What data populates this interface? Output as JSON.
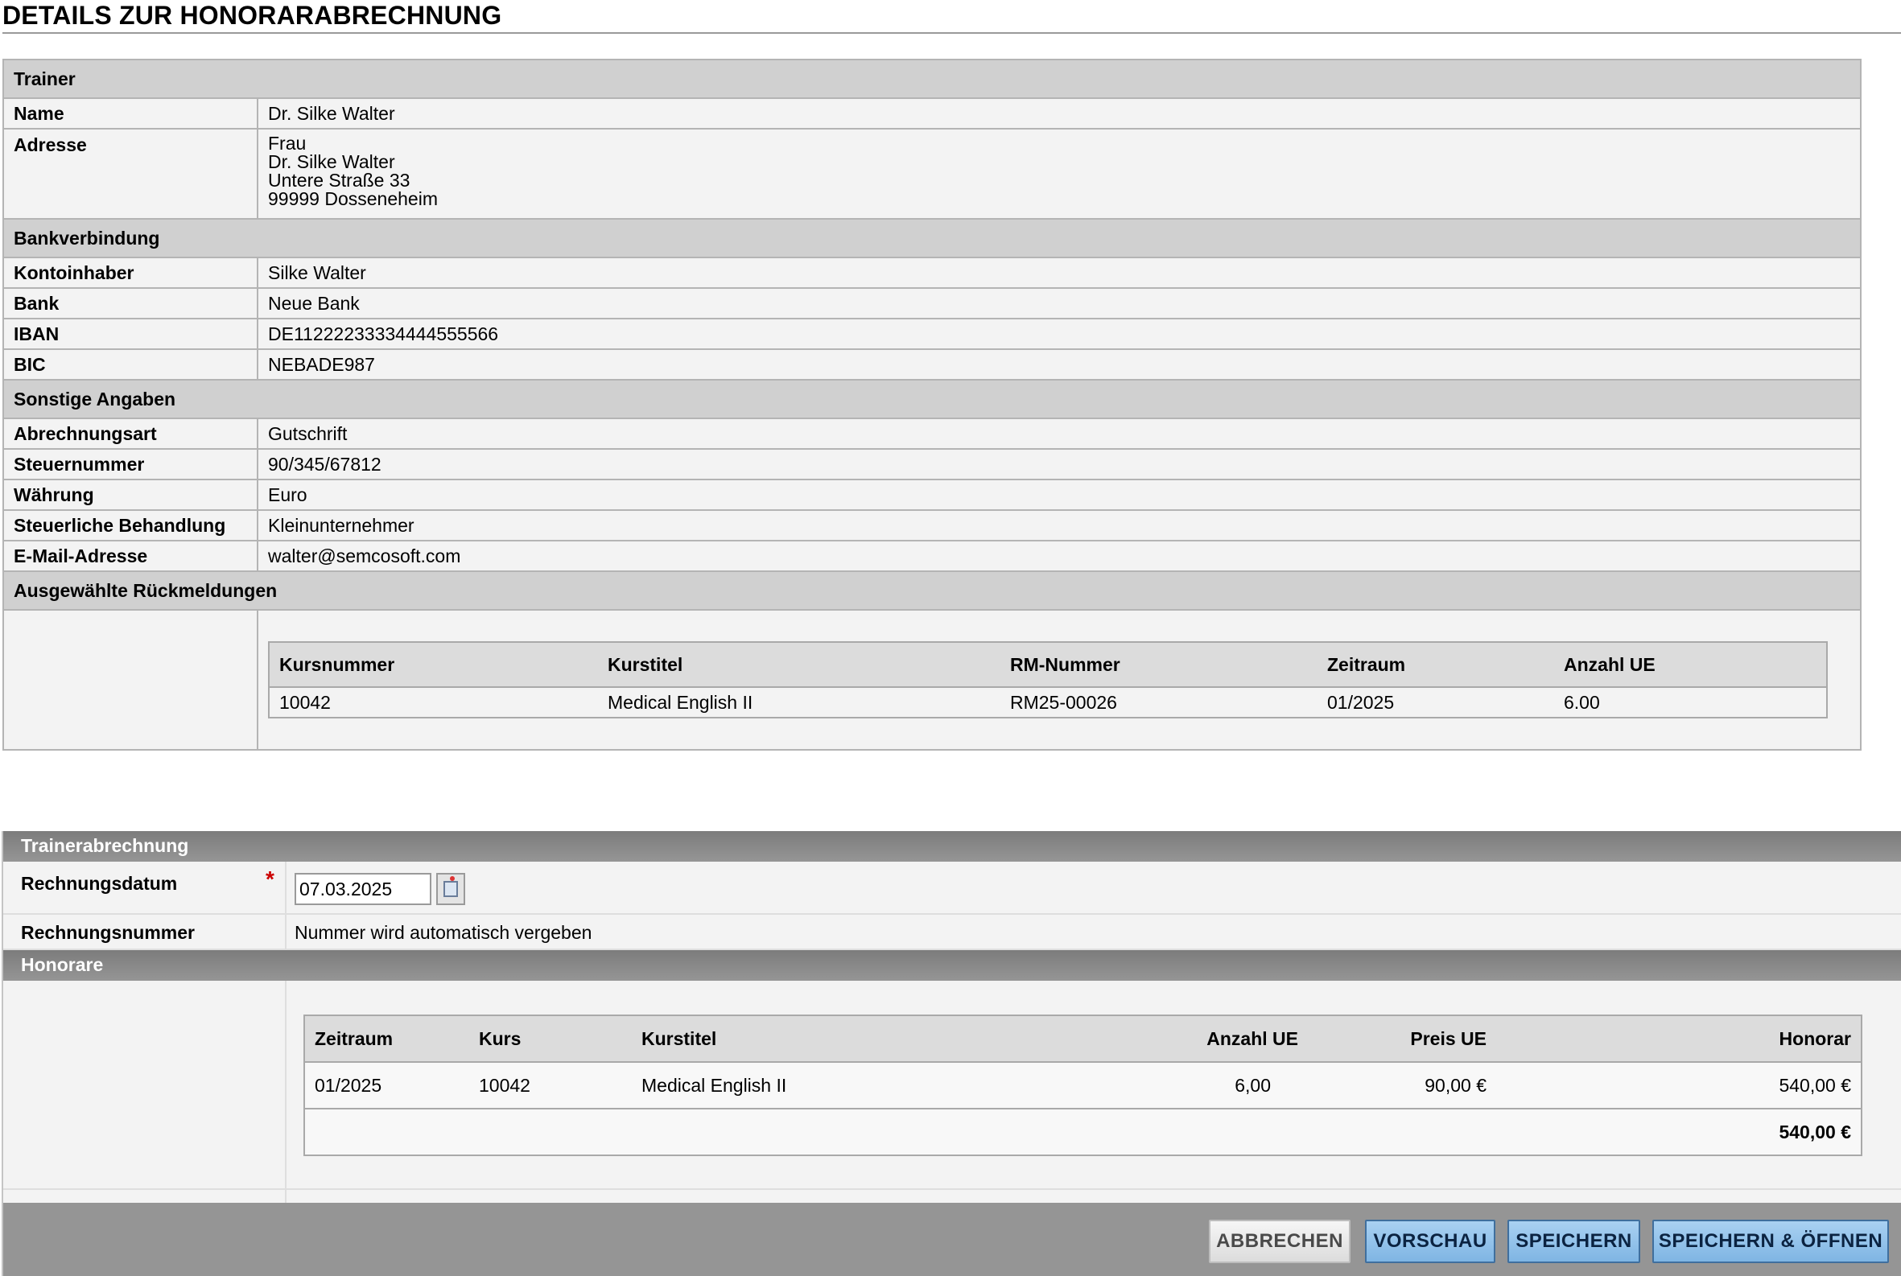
{
  "page_title": "DETAILS ZUR HONORARABRECHNUNG",
  "trainer": {
    "section": "Trainer",
    "name_label": "Name",
    "name_value": "Dr. Silke Walter",
    "address_label": "Adresse",
    "address_lines": [
      "Frau",
      "Dr. Silke Walter",
      "Untere Straße 33",
      "99999 Dosseneheim"
    ]
  },
  "bank": {
    "section": "Bankverbindung",
    "rows": [
      {
        "label": "Kontoinhaber",
        "value": "Silke Walter"
      },
      {
        "label": "Bank",
        "value": "Neue Bank"
      },
      {
        "label": "IBAN",
        "value": "DE11222233334444555566"
      },
      {
        "label": "BIC",
        "value": "NEBADE987"
      }
    ]
  },
  "other": {
    "section": "Sonstige Angaben",
    "rows": [
      {
        "label": "Abrechnungsart",
        "value": "Gutschrift"
      },
      {
        "label": "Steuernummer",
        "value": "90/345/67812"
      },
      {
        "label": "Währung",
        "value": "Euro"
      },
      {
        "label": "Steuerliche Behandlung",
        "value": "Kleinunternehmer"
      },
      {
        "label": "E-Mail-Adresse",
        "value": "walter@semcosoft.com"
      }
    ]
  },
  "feedback": {
    "section": "Ausgewählte Rückmeldungen",
    "columns": [
      "Kursnummer",
      "Kurstitel",
      "RM-Nummer",
      "Zeitraum",
      "Anzahl UE"
    ],
    "rows": [
      [
        "10042",
        "Medical English II",
        "RM25-00026",
        "01/2025",
        "6.00"
      ]
    ]
  },
  "invoice": {
    "section": "Trainerabrechnung",
    "date_label": "Rechnungsdatum",
    "required_mark": "*",
    "date_value": "07.03.2025",
    "number_label": "Rechnungsnummer",
    "number_value": "Nummer wird automatisch vergeben"
  },
  "fees": {
    "section": "Honorare",
    "columns": [
      "Zeitraum",
      "Kurs",
      "Kurstitel",
      "Anzahl UE",
      "Preis UE",
      "Honorar"
    ],
    "rows": [
      [
        "01/2025",
        "10042",
        "Medical English II",
        "6,00",
        "90,00 €",
        "540,00 €"
      ]
    ],
    "total": "540,00 €"
  },
  "buttons": {
    "cancel": "ABBRECHEN",
    "preview": "VORSCHAU",
    "save": "SPEICHERN",
    "save_open": "SPEICHERN & ÖFFNEN"
  },
  "icons": {
    "date_picker": "calendar-icon"
  },
  "colors": {
    "section_bar": "#d0d0d0",
    "form_bar": "#8a8a8a",
    "primary_button": "#8fc0ea",
    "required": "#cc0000"
  }
}
